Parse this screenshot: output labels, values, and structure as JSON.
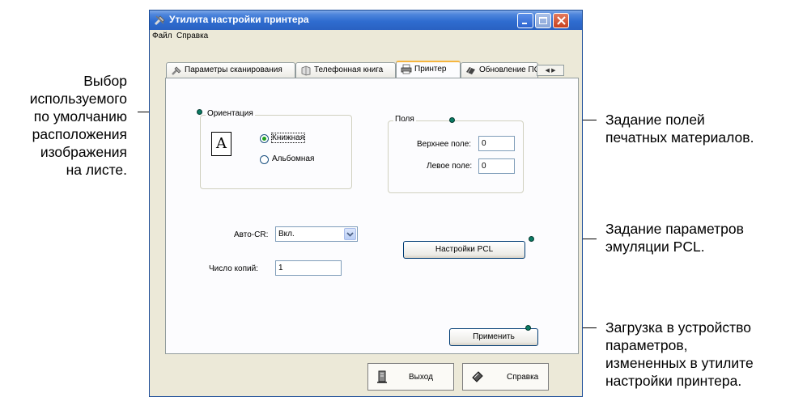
{
  "window": {
    "title": "Утилита настройки принтера",
    "menu": [
      "Файл",
      "Справка"
    ]
  },
  "tabs": [
    {
      "label": "Параметры сканирования",
      "icon": "tools-icon"
    },
    {
      "label": "Телефонная книга",
      "icon": "phonebook-icon"
    },
    {
      "label": "Принтер",
      "icon": "printer-icon",
      "active": true
    },
    {
      "label": "Обновление ПО",
      "icon": "update-icon"
    }
  ],
  "orientation": {
    "legend": "Ориентация",
    "options": [
      "Книжная",
      "Альбомная"
    ],
    "selected": "Книжная",
    "icon_letter": "A"
  },
  "margins": {
    "legend": "Поля",
    "top_label": "Верхнее поле:",
    "top_value": "0",
    "left_label": "Левое поле:",
    "left_value": "0"
  },
  "auto_cr": {
    "label": "Авто-CR:",
    "value": "Вкл."
  },
  "copies": {
    "label": "Число копий:",
    "value": "1"
  },
  "buttons": {
    "pcl": "Настройки PCL",
    "apply": "Применить",
    "exit": "Выход",
    "help": "Справка"
  },
  "callouts": {
    "orientation": "Выбор\nиспользуемого\nпо умолчанию\nрасположения\nизображения\nна листе.",
    "margins": "Задание полей\nпечатных материалов.",
    "pcl": "Задание параметров\nэмуляции PCL.",
    "apply": "Загрузка в устройство\nпараметров,\nизмененных в утилите\nнастройки принтера."
  },
  "colors": {
    "accent_dot": "#0b7a63",
    "titlebar": "#2f6dd0"
  }
}
